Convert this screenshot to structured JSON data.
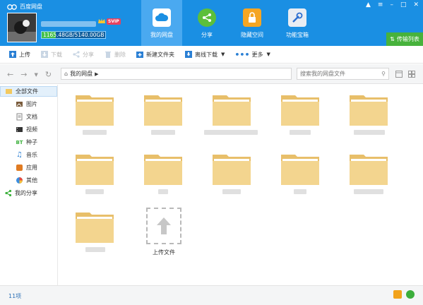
{
  "app": {
    "title": "百度网盘"
  },
  "user": {
    "vip_badge": "SVIP",
    "quota_text": "1165.48GB/5140.00GB",
    "quota_used_fraction": 0.227
  },
  "nav_tabs": [
    {
      "label": "我的网盘",
      "icon": "cloud-icon",
      "active": true
    },
    {
      "label": "分享",
      "icon": "share-icon",
      "active": false
    },
    {
      "label": "隐藏空间",
      "icon": "lock-icon",
      "active": false
    },
    {
      "label": "功能宝箱",
      "icon": "toolbox-icon",
      "active": false
    }
  ],
  "transfer_label": "传输列表",
  "toolbar": {
    "upload": "上传",
    "download": "下载",
    "share": "分享",
    "delete": "删除",
    "new_folder": "新建文件夹",
    "offline_download": "离线下载",
    "more": "更多"
  },
  "breadcrumb": {
    "root": "我的网盘"
  },
  "search": {
    "placeholder": "搜索我的网盘文件"
  },
  "sidebar": {
    "all_files": "全部文件",
    "items": [
      {
        "label": "图片",
        "icon": "image-icon"
      },
      {
        "label": "文档",
        "icon": "document-icon"
      },
      {
        "label": "视频",
        "icon": "video-icon"
      },
      {
        "label": "种子",
        "icon": "bt-icon"
      },
      {
        "label": "音乐",
        "icon": "music-icon"
      },
      {
        "label": "应用",
        "icon": "app-icon"
      },
      {
        "label": "其他",
        "icon": "other-icon"
      }
    ],
    "my_share": "我的分享"
  },
  "upload_tile_label": "上传文件",
  "status": {
    "count": "11项"
  },
  "colors": {
    "header": "#1a8fe3",
    "active_tab": "#4aa9f0",
    "folder": "#f3d58f",
    "transfer": "#47b23c"
  }
}
